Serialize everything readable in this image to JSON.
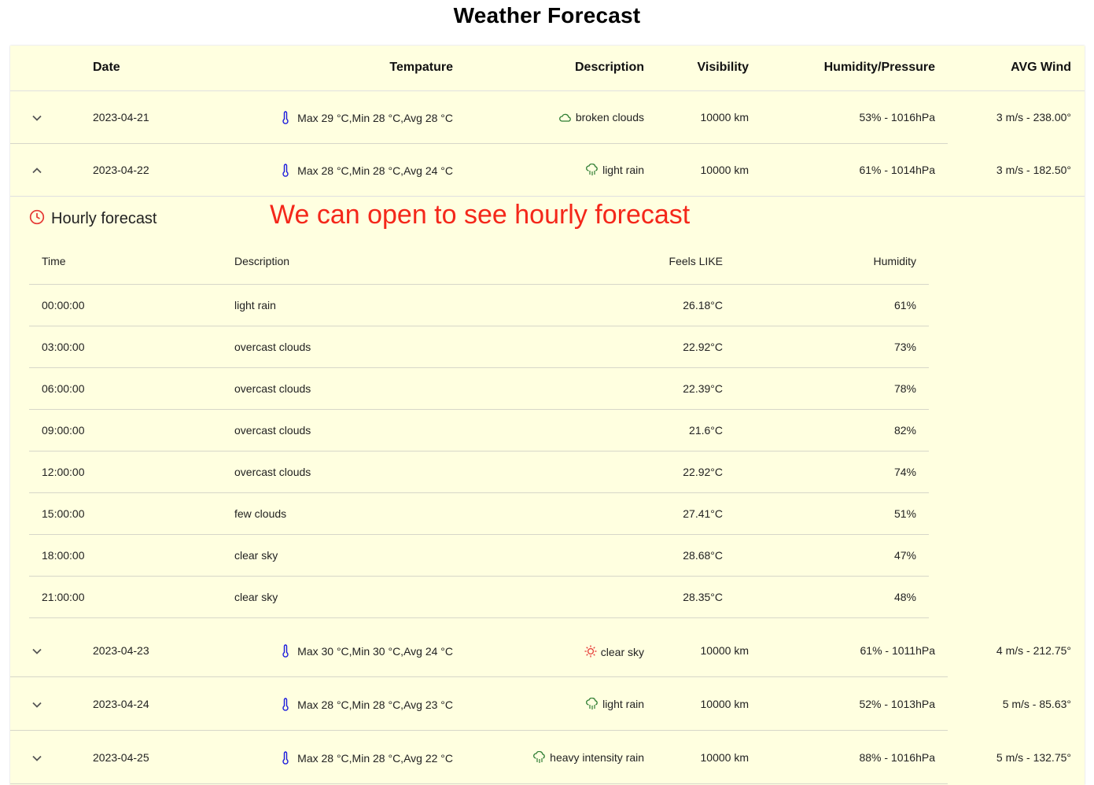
{
  "page": {
    "title": "Weather Forecast"
  },
  "annotation": "We can open to see hourly forecast",
  "colors": {
    "thermometer": "#1a1adc",
    "weather_icon": "#2e7d32",
    "sun_icon": "#e53935",
    "clock_icon": "#e53935",
    "card_bg": "#ffffe0"
  },
  "table": {
    "headers": {
      "date": "Date",
      "temperature": "Tempature",
      "description": "Description",
      "visibility": "Visibility",
      "humidity_pressure": "Humidity/Pressure",
      "avg_wind": "AVG Wind"
    },
    "rows": [
      {
        "date": "2023-04-21",
        "temperature": "Max 29 °C,Min 28 °C,Avg 28 °C",
        "icon": "cloud-icon",
        "description": "broken clouds",
        "visibility": "10000 km",
        "humidity_pressure": "53% - 1016hPa",
        "avg_wind": "3 m/s - 238.00°",
        "expanded": false
      },
      {
        "date": "2023-04-22",
        "temperature": "Max 28 °C,Min 28 °C,Avg 24 °C",
        "icon": "rain-cloud-icon",
        "description": "light rain",
        "visibility": "10000 km",
        "humidity_pressure": "61% - 1014hPa",
        "avg_wind": "3 m/s - 182.50°",
        "expanded": true
      },
      {
        "date": "2023-04-23",
        "temperature": "Max 30 °C,Min 30 °C,Avg 24 °C",
        "icon": "sun-icon",
        "description": "clear sky",
        "visibility": "10000 km",
        "humidity_pressure": "61% - 1011hPa",
        "avg_wind": "4 m/s - 212.75°",
        "expanded": false
      },
      {
        "date": "2023-04-24",
        "temperature": "Max 28 °C,Min 28 °C,Avg 23 °C",
        "icon": "rain-cloud-icon",
        "description": "light rain",
        "visibility": "10000 km",
        "humidity_pressure": "52% - 1013hPa",
        "avg_wind": "5 m/s - 85.63°",
        "expanded": false
      },
      {
        "date": "2023-04-25",
        "temperature": "Max 28 °C,Min 28 °C,Avg 22 °C",
        "icon": "rain-cloud-icon",
        "description": "heavy intensity rain",
        "visibility": "10000 km",
        "humidity_pressure": "88% - 1016hPa",
        "avg_wind": "5 m/s - 132.75°",
        "expanded": false
      }
    ]
  },
  "hourly": {
    "title": "Hourly forecast",
    "headers": {
      "time": "Time",
      "description": "Description",
      "feels_like": "Feels LIKE",
      "humidity": "Humidity"
    },
    "rows": [
      {
        "time": "00:00:00",
        "description": "light rain",
        "feels_like": "26.18°C",
        "humidity": "61%"
      },
      {
        "time": "03:00:00",
        "description": "overcast clouds",
        "feels_like": "22.92°C",
        "humidity": "73%"
      },
      {
        "time": "06:00:00",
        "description": "overcast clouds",
        "feels_like": "22.39°C",
        "humidity": "78%"
      },
      {
        "time": "09:00:00",
        "description": "overcast clouds",
        "feels_like": "21.6°C",
        "humidity": "82%"
      },
      {
        "time": "12:00:00",
        "description": "overcast clouds",
        "feels_like": "22.92°C",
        "humidity": "74%"
      },
      {
        "time": "15:00:00",
        "description": "few clouds",
        "feels_like": "27.41°C",
        "humidity": "51%"
      },
      {
        "time": "18:00:00",
        "description": "clear sky",
        "feels_like": "28.68°C",
        "humidity": "47%"
      },
      {
        "time": "21:00:00",
        "description": "clear sky",
        "feels_like": "28.35°C",
        "humidity": "48%"
      }
    ]
  }
}
